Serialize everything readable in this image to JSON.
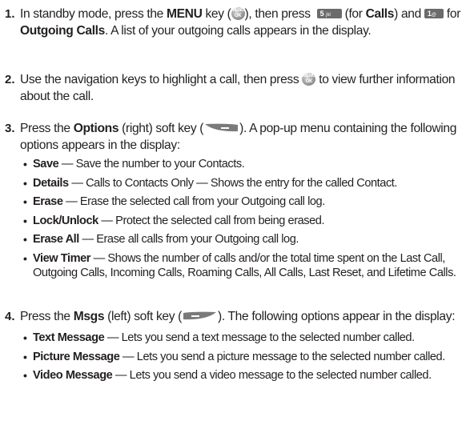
{
  "steps": [
    {
      "number": "1.",
      "t1": "In standby mode, press the ",
      "b1": "MENU",
      "t2": " key (",
      "t3": "), then press ",
      "t4": " (for ",
      "b2": "Calls",
      "t5": ") and ",
      "t6": " for ",
      "b3": "Outgoing Calls",
      "t7": ". A list of your outgoing calls appears in the display.",
      "icons": [
        "ok-menu-key-icon",
        "key-5-icon",
        "key-1-icon"
      ]
    },
    {
      "number": "2.",
      "t1": "Use the navigation keys to highlight a call, then press ",
      "t2": " to view further information about the call."
    },
    {
      "number": "3.",
      "t1": "Press the ",
      "b1": "Options",
      "t2": " (right) soft key (",
      "t3": "). A pop-up menu containing the following options appears in the display:",
      "options": [
        {
          "label": "Save",
          "desc": " — Save the number to your Contacts."
        },
        {
          "label": "Details",
          "desc": " — Calls to Contacts Only — Shows the entry for the called Contact."
        },
        {
          "label": "Erase",
          "desc": " — Erase the selected call from your Outgoing call log."
        },
        {
          "label": "Lock/Unlock",
          "desc": " — Protect the selected call from being erased."
        },
        {
          "label": "Erase All",
          "desc": " — Erase all calls from your Outgoing call log."
        },
        {
          "label": "View Timer",
          "desc": " — Shows the number of calls and/or the total time spent on the Last Call, Outgoing Calls, Incoming Calls, Roaming Calls, All Calls, Last Reset, and Lifetime Calls."
        }
      ]
    },
    {
      "number": "4.",
      "t1": "Press the ",
      "b1": "Msgs",
      "t2": " (left) soft key (",
      "t3": "). The following options appear in the display:",
      "options": [
        {
          "label": "Text Message",
          "desc": " — Lets you send a text message to the selected number called."
        },
        {
          "label": "Picture Message",
          "desc": " — Lets you send a picture message to the selected number called."
        },
        {
          "label": "Video Message",
          "desc": " — Lets you send a video message to the selected number called."
        }
      ]
    }
  ],
  "key_labels": {
    "menu_top": "MENU",
    "menu_bottom": "OK",
    "key5": "5",
    "key5_sub": "jkl",
    "key1": "1",
    "key1_sub": "@"
  },
  "colors": {
    "text": "#231f20",
    "key_gray": "#6b6b6b",
    "softkey_gray": "#7a7a7a"
  }
}
